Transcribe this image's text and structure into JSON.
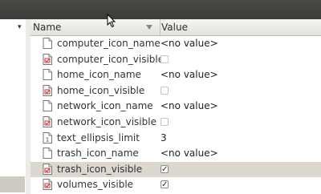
{
  "columns": {
    "name": "Name",
    "value": "Value"
  },
  "rows": [
    {
      "name": "computer_icon_name",
      "type": "string",
      "value": "<no value>",
      "selected": false
    },
    {
      "name": "computer_icon_visible",
      "type": "bool",
      "checked": false,
      "selected": false
    },
    {
      "name": "home_icon_name",
      "type": "string",
      "value": "<no value>",
      "selected": false
    },
    {
      "name": "home_icon_visible",
      "type": "bool",
      "checked": false,
      "selected": false
    },
    {
      "name": "network_icon_name",
      "type": "string",
      "value": "<no value>",
      "selected": false
    },
    {
      "name": "network_icon_visible",
      "type": "bool",
      "checked": false,
      "selected": false
    },
    {
      "name": "text_ellipsis_limit",
      "type": "int",
      "value": "3",
      "selected": false
    },
    {
      "name": "trash_icon_name",
      "type": "string",
      "value": "<no value>",
      "selected": false
    },
    {
      "name": "trash_icon_visible",
      "type": "bool",
      "checked": true,
      "selected": true
    },
    {
      "name": "volumes_visible",
      "type": "bool",
      "checked": true,
      "selected": false
    }
  ],
  "colors": {
    "selection": "#dcd7cf",
    "title_bar": "#3c3b37",
    "check_mark": "#2b2b2b"
  }
}
